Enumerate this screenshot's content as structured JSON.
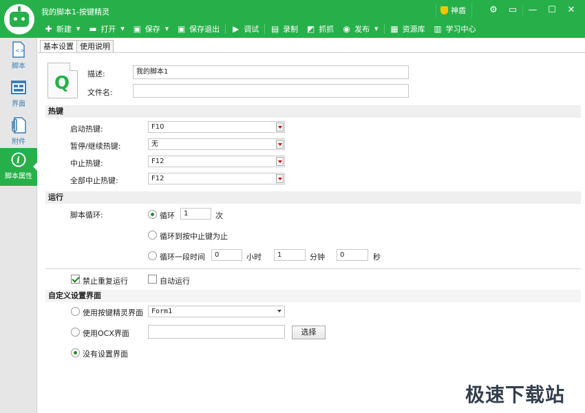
{
  "window": {
    "title": "我的脚本1-按键精灵",
    "badge": "神盾",
    "colors": {
      "accent": "#27b04a"
    }
  },
  "toolbar": {
    "new": "新建",
    "open": "打开",
    "save": "保存",
    "save_exit": "保存退出",
    "debug": "调试",
    "record": "录制",
    "capture": "抓抓",
    "publish": "发布",
    "resources": "资源库",
    "learning": "学习中心"
  },
  "sidebar": {
    "items": [
      {
        "label": "脚本"
      },
      {
        "label": "界面"
      },
      {
        "label": "附件"
      },
      {
        "label": "脚本属性"
      }
    ]
  },
  "tabs": [
    {
      "label": "基本设置"
    },
    {
      "label": "使用说明"
    }
  ],
  "basic": {
    "desc_label": "描述:",
    "desc_value": "我的脚本1",
    "filename_label": "文件名:",
    "filename_value": ""
  },
  "hotkeys": {
    "section": "热键",
    "start_label": "启动热键:",
    "start_value": "F10",
    "pause_label": "暂停/继续热键:",
    "pause_value": "无",
    "stop_label": "中止热键:",
    "stop_value": "F12",
    "stopall_label": "全部中止热键:",
    "stopall_value": "F12"
  },
  "run": {
    "section": "运行",
    "loop_label": "脚本循环:",
    "loop_option": "循环",
    "loop_count": "1",
    "loop_unit": "次",
    "until_option": "循环到按中止键为止",
    "timed_option": "循环一段时间",
    "hours": "0",
    "hours_unit": "小时",
    "minutes": "1",
    "minutes_unit": "分钟",
    "seconds": "0",
    "seconds_unit": "秒"
  },
  "options": {
    "no_repeat": "禁止重复运行",
    "auto_run": "自动运行"
  },
  "custom_ui": {
    "section": "自定义设置界面",
    "use_builtin": "使用按键精灵界面",
    "builtin_value": "Form1",
    "use_ocx": "使用OCX界面",
    "ocx_value": "",
    "choose_button": "选择",
    "none": "没有设置界面"
  },
  "watermark": "极速下载站"
}
